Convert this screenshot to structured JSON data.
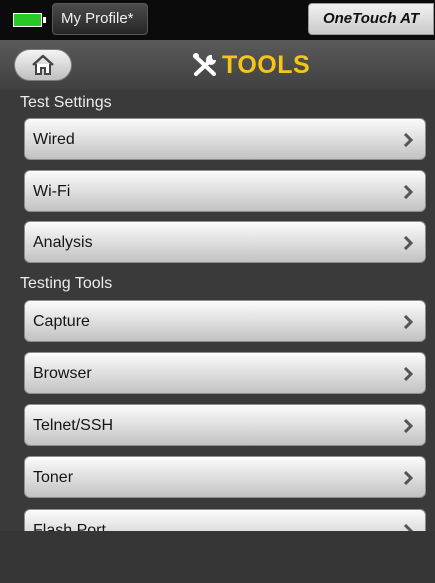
{
  "status_bar": {
    "profile_label": "My Profile*",
    "device_label": "OneTouch AT"
  },
  "header": {
    "title": "TOOLS",
    "home_icon": "home-icon",
    "title_icon": "wrench-screwdriver-icon"
  },
  "sections": [
    {
      "label": "Test Settings",
      "items": [
        "Wired",
        "Wi-Fi",
        "Analysis"
      ]
    },
    {
      "label": "Testing Tools",
      "items": [
        "Capture",
        "Browser",
        "Telnet/SSH",
        "Toner",
        "Flash Port"
      ]
    }
  ],
  "colors": {
    "accent": "#f5c518",
    "battery": "#29c829",
    "background": "#3a3a3a"
  }
}
